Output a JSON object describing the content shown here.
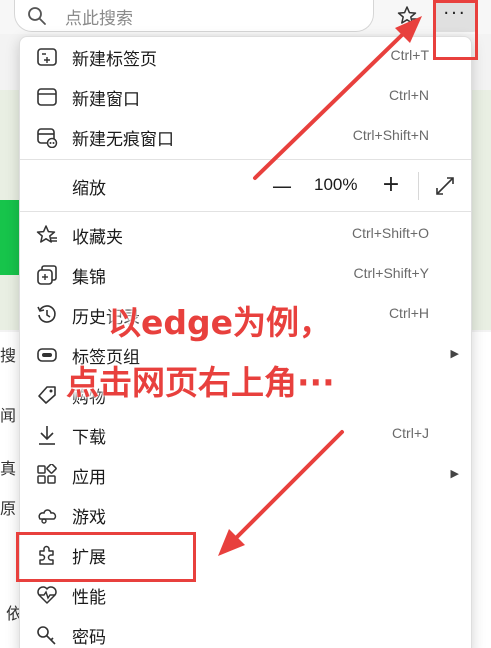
{
  "topbar": {
    "search_placeholder": "点此搜索",
    "more_label": "···"
  },
  "menu": {
    "new_tab": {
      "label": "新建标签页",
      "shortcut": "Ctrl+T"
    },
    "new_window": {
      "label": "新建窗口",
      "shortcut": "Ctrl+N"
    },
    "new_inprivate": {
      "label": "新建无痕窗口",
      "shortcut": "Ctrl+Shift+N"
    },
    "zoom": {
      "label": "缩放",
      "minus": "—",
      "value": "100%",
      "plus": "+"
    },
    "favorites": {
      "label": "收藏夹",
      "shortcut": "Ctrl+Shift+O"
    },
    "collections": {
      "label": "集锦",
      "shortcut": "Ctrl+Shift+Y"
    },
    "history": {
      "label": "历史记录",
      "shortcut": "Ctrl+H"
    },
    "tab_groups": {
      "label": "标签页组"
    },
    "shopping": {
      "label": "购物"
    },
    "downloads": {
      "label": "下载",
      "shortcut": "Ctrl+J"
    },
    "apps": {
      "label": "应用"
    },
    "games": {
      "label": "游戏"
    },
    "extensions": {
      "label": "扩展"
    },
    "performance": {
      "label": "性能"
    },
    "passwords": {
      "label": "密码"
    }
  },
  "background": {
    "text_1": "搜",
    "text_2": "闻",
    "text_3": "真",
    "text_4": "原",
    "text_5": "依"
  },
  "annotation": {
    "line_1": "以edge为例，",
    "line_2": "点击网页右上角···",
    "color": "#e8403d"
  }
}
